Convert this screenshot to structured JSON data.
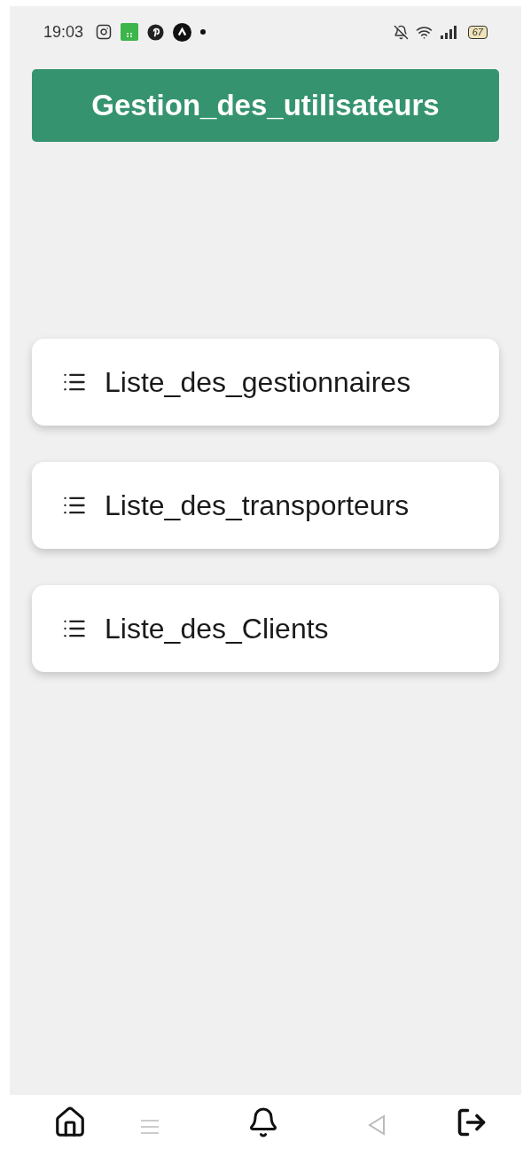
{
  "status_bar": {
    "time": "19:03",
    "battery": "67"
  },
  "header": {
    "title": "Gestion_des_utilisateurs"
  },
  "menu_items": [
    {
      "label": "Liste_des_gestionnaires"
    },
    {
      "label": "Liste_des_transporteurs"
    },
    {
      "label": "Liste_des_Clients"
    }
  ]
}
